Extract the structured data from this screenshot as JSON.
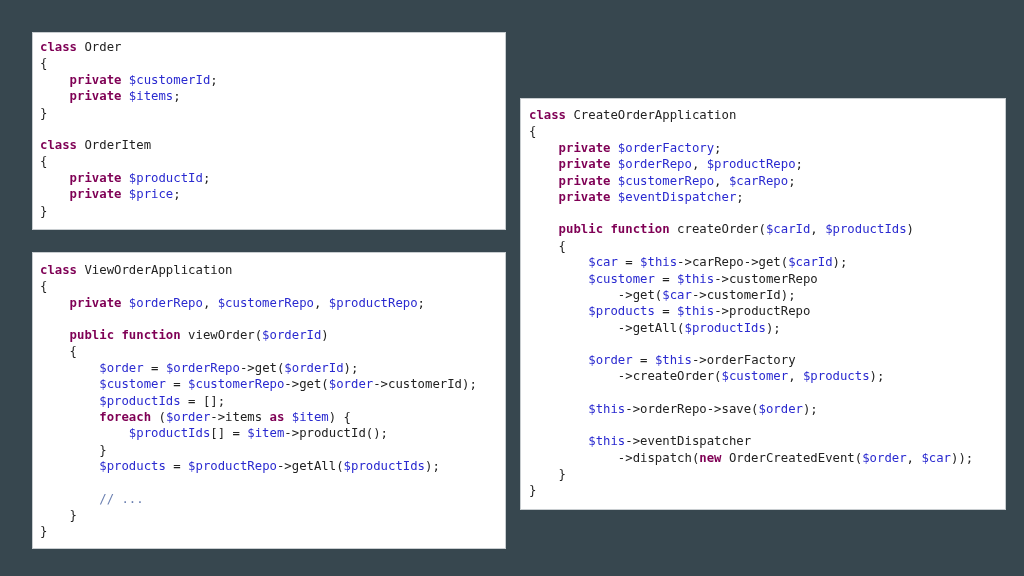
{
  "panels": [
    {
      "blocks": [
        [
          [
            {
              "kind": "keyword",
              "text": "class"
            },
            {
              "kind": "plain",
              "text": " Order"
            }
          ],
          [
            {
              "kind": "plain",
              "text": "{"
            }
          ],
          [
            {
              "kind": "keyword",
              "text": "    private "
            },
            {
              "kind": "variable",
              "text": "$customerId"
            },
            {
              "kind": "plain",
              "text": ";"
            }
          ],
          [
            {
              "kind": "keyword",
              "text": "    private "
            },
            {
              "kind": "variable",
              "text": "$items"
            },
            {
              "kind": "plain",
              "text": ";"
            }
          ],
          [
            {
              "kind": "plain",
              "text": "}"
            }
          ]
        ],
        [
          [
            {
              "kind": "keyword",
              "text": "class"
            },
            {
              "kind": "plain",
              "text": " OrderItem"
            }
          ],
          [
            {
              "kind": "plain",
              "text": "{"
            }
          ],
          [
            {
              "kind": "keyword",
              "text": "    private "
            },
            {
              "kind": "variable",
              "text": "$productId"
            },
            {
              "kind": "plain",
              "text": ";"
            }
          ],
          [
            {
              "kind": "keyword",
              "text": "    private "
            },
            {
              "kind": "variable",
              "text": "$price"
            },
            {
              "kind": "plain",
              "text": ";"
            }
          ],
          [
            {
              "kind": "plain",
              "text": "}"
            }
          ]
        ]
      ]
    },
    {
      "blocks": [
        [
          [
            {
              "kind": "keyword",
              "text": "class"
            },
            {
              "kind": "plain",
              "text": " ViewOrderApplication"
            }
          ],
          [
            {
              "kind": "plain",
              "text": "{"
            }
          ],
          [
            {
              "kind": "keyword",
              "text": "    private "
            },
            {
              "kind": "variable",
              "text": "$orderRepo"
            },
            {
              "kind": "plain",
              "text": ", "
            },
            {
              "kind": "variable",
              "text": "$customerRepo"
            },
            {
              "kind": "plain",
              "text": ", "
            },
            {
              "kind": "variable",
              "text": "$productRepo"
            },
            {
              "kind": "plain",
              "text": ";"
            }
          ]
        ],
        [
          [
            {
              "kind": "keyword",
              "text": "    public "
            },
            {
              "kind": "keyword",
              "text": "function"
            },
            {
              "kind": "plain",
              "text": " viewOrder("
            },
            {
              "kind": "variable",
              "text": "$orderId"
            },
            {
              "kind": "plain",
              "text": ")"
            }
          ],
          [
            {
              "kind": "plain",
              "text": "    {"
            }
          ],
          [
            {
              "kind": "variable",
              "text": "        $order"
            },
            {
              "kind": "plain",
              "text": " = "
            },
            {
              "kind": "variable",
              "text": "$orderRepo"
            },
            {
              "kind": "plain",
              "text": "->get("
            },
            {
              "kind": "variable",
              "text": "$orderId"
            },
            {
              "kind": "plain",
              "text": ");"
            }
          ],
          [
            {
              "kind": "variable",
              "text": "        $customer"
            },
            {
              "kind": "plain",
              "text": " = "
            },
            {
              "kind": "variable",
              "text": "$customerRepo"
            },
            {
              "kind": "plain",
              "text": "->get("
            },
            {
              "kind": "variable",
              "text": "$order"
            },
            {
              "kind": "plain",
              "text": "->customerId);"
            }
          ],
          [
            {
              "kind": "variable",
              "text": "        $productIds"
            },
            {
              "kind": "plain",
              "text": " = [];"
            }
          ],
          [
            {
              "kind": "keyword",
              "text": "        foreach"
            },
            {
              "kind": "plain",
              "text": " ("
            },
            {
              "kind": "variable",
              "text": "$order"
            },
            {
              "kind": "plain",
              "text": "->items "
            },
            {
              "kind": "keyword",
              "text": "as "
            },
            {
              "kind": "variable",
              "text": "$item"
            },
            {
              "kind": "plain",
              "text": ") {"
            }
          ],
          [
            {
              "kind": "variable",
              "text": "            $productIds"
            },
            {
              "kind": "plain",
              "text": "[] = "
            },
            {
              "kind": "variable",
              "text": "$item"
            },
            {
              "kind": "plain",
              "text": "->productId();"
            }
          ],
          [
            {
              "kind": "plain",
              "text": "        }"
            }
          ],
          [
            {
              "kind": "variable",
              "text": "        $products"
            },
            {
              "kind": "plain",
              "text": " = "
            },
            {
              "kind": "variable",
              "text": "$productRepo"
            },
            {
              "kind": "plain",
              "text": "->getAll("
            },
            {
              "kind": "variable",
              "text": "$productIds"
            },
            {
              "kind": "plain",
              "text": ");"
            }
          ]
        ],
        [
          [
            {
              "kind": "comment",
              "text": "        // ..."
            }
          ],
          [
            {
              "kind": "plain",
              "text": "    }"
            }
          ],
          [
            {
              "kind": "plain",
              "text": "}"
            }
          ]
        ]
      ]
    },
    {
      "blocks": [
        [
          [
            {
              "kind": "keyword",
              "text": "class"
            },
            {
              "kind": "plain",
              "text": " CreateOrderApplication"
            }
          ],
          [
            {
              "kind": "plain",
              "text": "{"
            }
          ],
          [
            {
              "kind": "keyword",
              "text": "    private "
            },
            {
              "kind": "variable",
              "text": "$orderFactory"
            },
            {
              "kind": "plain",
              "text": ";"
            }
          ],
          [
            {
              "kind": "keyword",
              "text": "    private "
            },
            {
              "kind": "variable",
              "text": "$orderRepo"
            },
            {
              "kind": "plain",
              "text": ", "
            },
            {
              "kind": "variable",
              "text": "$productRepo"
            },
            {
              "kind": "plain",
              "text": ";"
            }
          ],
          [
            {
              "kind": "keyword",
              "text": "    private "
            },
            {
              "kind": "variable",
              "text": "$customerRepo"
            },
            {
              "kind": "plain",
              "text": ", "
            },
            {
              "kind": "variable",
              "text": "$carRepo"
            },
            {
              "kind": "plain",
              "text": ";"
            }
          ],
          [
            {
              "kind": "keyword",
              "text": "    private "
            },
            {
              "kind": "variable",
              "text": "$eventDispatcher"
            },
            {
              "kind": "plain",
              "text": ";"
            }
          ]
        ],
        [
          [
            {
              "kind": "keyword",
              "text": "    public "
            },
            {
              "kind": "keyword",
              "text": "function"
            },
            {
              "kind": "plain",
              "text": " createOrder("
            },
            {
              "kind": "variable",
              "text": "$carId"
            },
            {
              "kind": "plain",
              "text": ", "
            },
            {
              "kind": "variable",
              "text": "$productIds"
            },
            {
              "kind": "plain",
              "text": ")"
            }
          ],
          [
            {
              "kind": "plain",
              "text": "    {"
            }
          ],
          [
            {
              "kind": "variable",
              "text": "        $car"
            },
            {
              "kind": "plain",
              "text": " = "
            },
            {
              "kind": "variable",
              "text": "$this"
            },
            {
              "kind": "plain",
              "text": "->carRepo->get("
            },
            {
              "kind": "variable",
              "text": "$carId"
            },
            {
              "kind": "plain",
              "text": ");"
            }
          ],
          [
            {
              "kind": "variable",
              "text": "        $customer"
            },
            {
              "kind": "plain",
              "text": " = "
            },
            {
              "kind": "variable",
              "text": "$this"
            },
            {
              "kind": "plain",
              "text": "->customerRepo"
            }
          ],
          [
            {
              "kind": "plain",
              "text": "            ->get("
            },
            {
              "kind": "variable",
              "text": "$car"
            },
            {
              "kind": "plain",
              "text": "->customerId);"
            }
          ],
          [
            {
              "kind": "variable",
              "text": "        $products"
            },
            {
              "kind": "plain",
              "text": " = "
            },
            {
              "kind": "variable",
              "text": "$this"
            },
            {
              "kind": "plain",
              "text": "->productRepo"
            }
          ],
          [
            {
              "kind": "plain",
              "text": "            ->getAll("
            },
            {
              "kind": "variable",
              "text": "$productIds"
            },
            {
              "kind": "plain",
              "text": ");"
            }
          ]
        ],
        [
          [
            {
              "kind": "variable",
              "text": "        $order"
            },
            {
              "kind": "plain",
              "text": " = "
            },
            {
              "kind": "variable",
              "text": "$this"
            },
            {
              "kind": "plain",
              "text": "->orderFactory"
            }
          ],
          [
            {
              "kind": "plain",
              "text": "            ->createOrder("
            },
            {
              "kind": "variable",
              "text": "$customer"
            },
            {
              "kind": "plain",
              "text": ", "
            },
            {
              "kind": "variable",
              "text": "$products"
            },
            {
              "kind": "plain",
              "text": ");"
            }
          ]
        ],
        [
          [
            {
              "kind": "variable",
              "text": "        $this"
            },
            {
              "kind": "plain",
              "text": "->orderRepo->save("
            },
            {
              "kind": "variable",
              "text": "$order"
            },
            {
              "kind": "plain",
              "text": ");"
            }
          ]
        ],
        [
          [
            {
              "kind": "variable",
              "text": "        $this"
            },
            {
              "kind": "plain",
              "text": "->eventDispatcher"
            }
          ],
          [
            {
              "kind": "plain",
              "text": "            ->dispatch("
            },
            {
              "kind": "keyword",
              "text": "new"
            },
            {
              "kind": "plain",
              "text": " OrderCreatedEvent("
            },
            {
              "kind": "variable",
              "text": "$order"
            },
            {
              "kind": "plain",
              "text": ", "
            },
            {
              "kind": "variable",
              "text": "$car"
            },
            {
              "kind": "plain",
              "text": "));"
            }
          ],
          [
            {
              "kind": "plain",
              "text": "    }"
            }
          ],
          [
            {
              "kind": "plain",
              "text": "}"
            }
          ]
        ]
      ]
    }
  ]
}
